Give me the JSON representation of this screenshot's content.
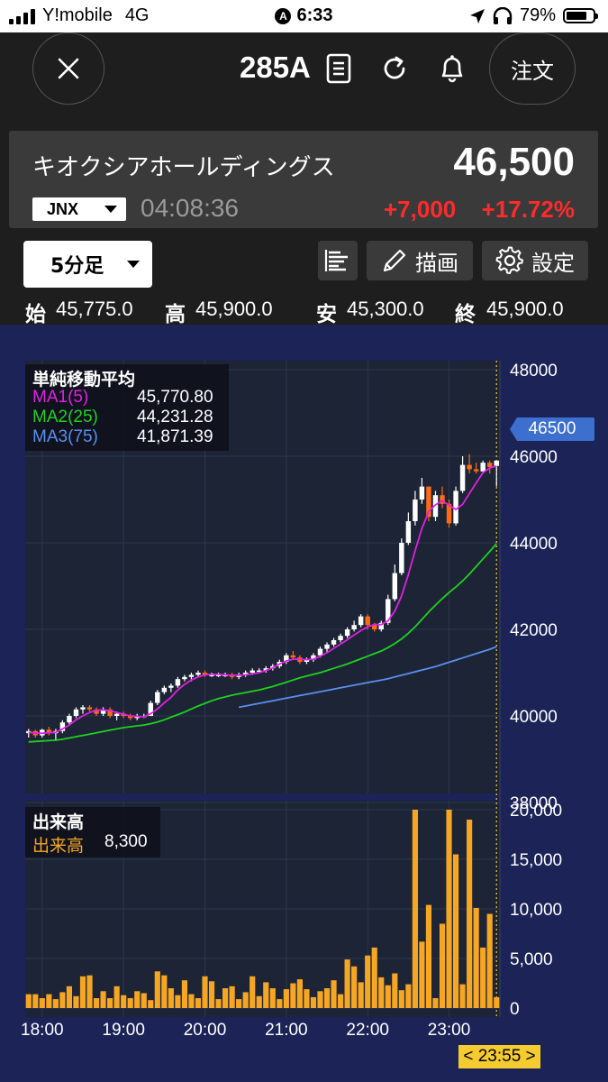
{
  "status_bar": {
    "carrier": "Y!mobile",
    "network": "4G",
    "time": "6:33",
    "battery": "79%",
    "battery_level": 0.79
  },
  "nav": {
    "ticker": "285A",
    "order_label": "注文"
  },
  "quote": {
    "company": "キオクシアホールディングス",
    "price": "46,500",
    "market": "JNX",
    "time": "04:08:36",
    "change": "+7,000",
    "change_pct": "+17.72%"
  },
  "toolbar": {
    "interval": "5分足",
    "draw_label": "描画",
    "settings_label": "設定"
  },
  "ohlc": {
    "open_label": "始",
    "open": "45,775.0",
    "high_label": "高",
    "high": "45,900.0",
    "low_label": "安",
    "low": "45,300.0",
    "close_label": "終",
    "close": "45,900.0"
  },
  "ma_legend": {
    "title": "単純移動平均",
    "ma1_label": "MA1(5)",
    "ma1_value": "45,770.80",
    "ma2_label": "MA2(25)",
    "ma2_value": "44,231.28",
    "ma3_label": "MA3(75)",
    "ma3_value": "41,871.39"
  },
  "vol_legend": {
    "title": "出来高",
    "label": "出来高",
    "value": "8,300"
  },
  "last_price_tag": "46500",
  "cursor_time": "< 23:55 >",
  "colors": {
    "up": "#ffffff",
    "down": "#ff6a14",
    "ma1": "#e020e0",
    "ma2": "#20d020",
    "ma3": "#5b8ef0",
    "volume": "#f5a623",
    "chart_bg": "#1b2357",
    "plot_bg": "#1c2436",
    "change": "#ff2b2b",
    "price_tag": "#3d6fcf",
    "cursor_tag": "#f5cc2f"
  },
  "chart_data": [
    {
      "type": "candlestick",
      "title": "",
      "y_ticks": [
        "48000",
        "46000",
        "44000",
        "42000",
        "40000",
        "38000"
      ],
      "ylim": [
        38000,
        48000
      ],
      "x_ticks": [
        "18:00",
        "19:00",
        "20:00",
        "21:00",
        "22:00",
        "23:00"
      ],
      "x_tick_index": [
        2,
        14,
        26,
        38,
        50,
        62
      ],
      "candles": [
        [
          39600,
          39700,
          39500,
          39650
        ],
        [
          39650,
          39680,
          39500,
          39550
        ],
        [
          39550,
          39700,
          39500,
          39680
        ],
        [
          39680,
          39750,
          39550,
          39600
        ],
        [
          39600,
          39700,
          39450,
          39650
        ],
        [
          39650,
          39900,
          39600,
          39850
        ],
        [
          39850,
          40050,
          39800,
          40000
        ],
        [
          40000,
          40200,
          39950,
          40150
        ],
        [
          40150,
          40250,
          40050,
          40200
        ],
        [
          40200,
          40250,
          40100,
          40150
        ],
        [
          40150,
          40200,
          40000,
          40050
        ],
        [
          40050,
          40200,
          40000,
          40150
        ],
        [
          40150,
          40200,
          39950,
          40000
        ],
        [
          40000,
          40100,
          39900,
          40050
        ],
        [
          40050,
          40100,
          39950,
          40000
        ],
        [
          40000,
          40050,
          39900,
          39950
        ],
        [
          39950,
          40050,
          39900,
          40000
        ],
        [
          40000,
          40050,
          39950,
          40000
        ],
        [
          40000,
          40350,
          40000,
          40300
        ],
        [
          40300,
          40600,
          40250,
          40550
        ],
        [
          40550,
          40700,
          40500,
          40650
        ],
        [
          40650,
          40750,
          40550,
          40700
        ],
        [
          40700,
          40900,
          40650,
          40850
        ],
        [
          40850,
          40950,
          40800,
          40900
        ],
        [
          40900,
          41000,
          40800,
          40950
        ],
        [
          40950,
          41050,
          40900,
          41000
        ],
        [
          41000,
          41050,
          40900,
          40950
        ],
        [
          40950,
          41000,
          40900,
          40950
        ],
        [
          40950,
          41000,
          40900,
          40950
        ],
        [
          40950,
          41000,
          40900,
          40950
        ],
        [
          40950,
          41000,
          40850,
          40900
        ],
        [
          40900,
          41000,
          40850,
          40950
        ],
        [
          40950,
          41050,
          40900,
          41000
        ],
        [
          41000,
          41100,
          40950,
          41050
        ],
        [
          41050,
          41100,
          41000,
          41050
        ],
        [
          41050,
          41150,
          41000,
          41100
        ],
        [
          41100,
          41200,
          41050,
          41150
        ],
        [
          41150,
          41300,
          41100,
          41250
        ],
        [
          41250,
          41450,
          41200,
          41400
        ],
        [
          41400,
          41500,
          41300,
          41350
        ],
        [
          41350,
          41400,
          41200,
          41250
        ],
        [
          41250,
          41350,
          41200,
          41300
        ],
        [
          41300,
          41450,
          41250,
          41400
        ],
        [
          41400,
          41600,
          41350,
          41550
        ],
        [
          41550,
          41700,
          41450,
          41650
        ],
        [
          41650,
          41800,
          41600,
          41750
        ],
        [
          41750,
          41900,
          41700,
          41850
        ],
        [
          41850,
          42050,
          41800,
          42000
        ],
        [
          42000,
          42200,
          41950,
          42100
        ],
        [
          42100,
          42350,
          42050,
          42300
        ],
        [
          42300,
          42350,
          42000,
          42100
        ],
        [
          42100,
          42150,
          41950,
          42000
        ],
        [
          42000,
          42200,
          41950,
          42150
        ],
        [
          42150,
          42800,
          42100,
          42700
        ],
        [
          42700,
          43500,
          42650,
          43300
        ],
        [
          43300,
          44100,
          43250,
          44000
        ],
        [
          44000,
          44700,
          43950,
          44500
        ],
        [
          44500,
          45200,
          44400,
          45000
        ],
        [
          45000,
          45500,
          44900,
          45300
        ],
        [
          45300,
          45300,
          44500,
          44600
        ],
        [
          44600,
          45200,
          44500,
          45100
        ],
        [
          45100,
          45300,
          44800,
          44900
        ],
        [
          44900,
          45000,
          44350,
          44450
        ],
        [
          44450,
          45300,
          44400,
          45200
        ],
        [
          45200,
          46000,
          45150,
          45800
        ],
        [
          45800,
          46050,
          45600,
          45700
        ],
        [
          45700,
          45850,
          45600,
          45650
        ],
        [
          45650,
          45900,
          45600,
          45850
        ],
        [
          45850,
          45900,
          45600,
          45750
        ],
        [
          45775,
          45900,
          45300,
          45900
        ]
      ],
      "ma1": [
        39620,
        39600,
        39600,
        39610,
        39620,
        39700,
        39790,
        39910,
        40000,
        40080,
        40130,
        40140,
        40120,
        40080,
        40040,
        40000,
        39990,
        39980,
        40050,
        40160,
        40300,
        40430,
        40600,
        40730,
        40830,
        40900,
        40950,
        40960,
        40960,
        40950,
        40940,
        40940,
        40950,
        40970,
        41000,
        41050,
        41110,
        41200,
        41270,
        41310,
        41310,
        41300,
        41310,
        41380,
        41460,
        41560,
        41660,
        41760,
        41870,
        41970,
        42060,
        42110,
        42110,
        42200,
        42420,
        42770,
        43270,
        43820,
        44330,
        44720,
        44880,
        44970,
        44870,
        44770,
        44890,
        45140,
        45380,
        45620,
        45730,
        45770
      ],
      "ma2_start": 0,
      "ma2": [
        39400,
        39410,
        39420,
        39430,
        39440,
        39460,
        39490,
        39520,
        39550,
        39580,
        39610,
        39640,
        39670,
        39700,
        39730,
        39750,
        39770,
        39790,
        39820,
        39860,
        39910,
        39970,
        40030,
        40090,
        40160,
        40230,
        40290,
        40350,
        40400,
        40440,
        40480,
        40510,
        40540,
        40570,
        40600,
        40640,
        40680,
        40730,
        40780,
        40830,
        40880,
        40920,
        40960,
        41000,
        41050,
        41100,
        41150,
        41200,
        41260,
        41320,
        41380,
        41440,
        41500,
        41580,
        41670,
        41780,
        41910,
        42060,
        42230,
        42400,
        42560,
        42710,
        42850,
        42980,
        43120,
        43280,
        43450,
        43630,
        43800,
        43980
      ],
      "ma3_start": 31,
      "ma3": [
        40200,
        40230,
        40260,
        40290,
        40320,
        40350,
        40380,
        40410,
        40440,
        40470,
        40500,
        40530,
        40560,
        40590,
        40620,
        40650,
        40680,
        40710,
        40740,
        40770,
        40800,
        40830,
        40860,
        40900,
        40940,
        40980,
        41020,
        41060,
        41100,
        41140,
        41190,
        41240,
        41290,
        41340,
        41390,
        41440,
        41490,
        41540,
        41600
      ]
    },
    {
      "type": "bar",
      "title": "",
      "y_ticks": [
        "20,000",
        "15,000",
        "10,000",
        "5,000",
        "0"
      ],
      "ylim": [
        0,
        20000
      ],
      "volumes": [
        1400,
        1400,
        1000,
        1400,
        900,
        1600,
        2200,
        1200,
        3200,
        3300,
        1000,
        1700,
        1000,
        2200,
        1300,
        1000,
        1700,
        1500,
        800,
        3700,
        3300,
        2000,
        1300,
        2800,
        1400,
        1000,
        3200,
        2700,
        900,
        2000,
        2200,
        900,
        1600,
        3200,
        1200,
        2600,
        2000,
        900,
        1900,
        2500,
        2900,
        1900,
        1100,
        1700,
        2000,
        2800,
        1400,
        4900,
        4200,
        2600,
        5300,
        6100,
        3100,
        2300,
        3500,
        1800,
        2400,
        20000,
        6700,
        10400,
        1000,
        8500,
        20000,
        15500,
        2400,
        19000,
        10100,
        6100,
        9500,
        1100
      ]
    }
  ]
}
